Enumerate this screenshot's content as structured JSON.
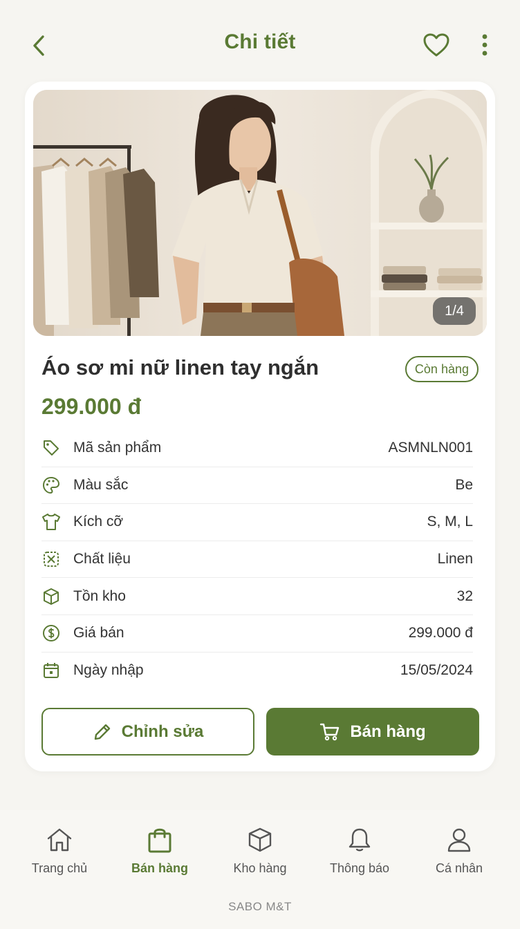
{
  "header": {
    "title": "Chi tiết",
    "back_icon": "chevron-left-icon",
    "favorite_icon": "heart-icon",
    "more_icon": "more-vertical-icon"
  },
  "product": {
    "image_counter": "1/4",
    "name": "Áo sơ mi nữ linen tay ngắn",
    "stock_status": "Còn hàng",
    "price": "299.000 đ"
  },
  "specs": [
    {
      "icon": "tag-icon",
      "label": "Mã sản phẩm",
      "value": "ASMNLN001"
    },
    {
      "icon": "palette-icon",
      "label": "Màu sắc",
      "value": "Be"
    },
    {
      "icon": "shirt-icon",
      "label": "Kích cỡ",
      "value": "S, M, L"
    },
    {
      "icon": "fabric-icon",
      "label": "Chất liệu",
      "value": "Linen"
    },
    {
      "icon": "box-icon",
      "label": "Tồn kho",
      "value": "32"
    },
    {
      "icon": "dollar-icon",
      "label": "Giá bán",
      "value": "299.000 đ"
    },
    {
      "icon": "calendar-icon",
      "label": "Ngày nhập",
      "value": "15/05/2024"
    }
  ],
  "actions": {
    "edit_label": "Chỉnh sửa",
    "sell_label": "Bán hàng"
  },
  "nav": {
    "items": [
      {
        "icon": "home-icon",
        "label": "Trang chủ",
        "active": false
      },
      {
        "icon": "shopping-bag-icon",
        "label": "Bán hàng",
        "active": true
      },
      {
        "icon": "box-icon",
        "label": "Kho hàng",
        "active": false
      },
      {
        "icon": "bell-icon",
        "label": "Thông báo",
        "active": false
      },
      {
        "icon": "user-icon",
        "label": "Cá nhân",
        "active": false
      }
    ],
    "brand": "SABO M&T"
  },
  "colors": {
    "accent": "#5a7a34",
    "background": "#f6f5f1",
    "card": "#ffffff"
  }
}
